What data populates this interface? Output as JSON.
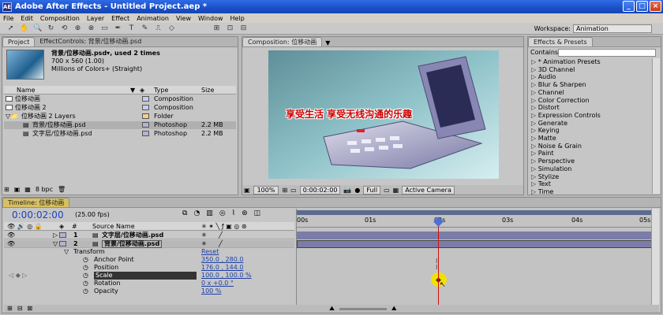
{
  "window": {
    "title": "Adobe After Effects - Untitled Project.aep *",
    "app_icon": "AE"
  },
  "menu": [
    "File",
    "Edit",
    "Composition",
    "Layer",
    "Effect",
    "Animation",
    "View",
    "Window",
    "Help"
  ],
  "workspace": {
    "label": "Workspace:",
    "value": "Animation"
  },
  "project": {
    "tabs": [
      "Project",
      "EffectControls: 背景/位移动画.psd"
    ],
    "info_name": "背景/位移动画.psd▾, used 2 times",
    "info_size": "700 x 560 (1.00)",
    "info_color": "Millions of Colors+ (Straight)",
    "columns": [
      "Name",
      "Type",
      "Size"
    ],
    "items": [
      {
        "name": "位移动画",
        "type": "Composition",
        "size": "",
        "label_color": "#c9c9f0",
        "icon": "composition-icon"
      },
      {
        "name": "位移动画 2",
        "type": "Composition",
        "size": "",
        "label_color": "#c9c9f0",
        "icon": "composition-icon"
      },
      {
        "name": "位移动画 2 Layers",
        "type": "Folder",
        "size": "",
        "label_color": "#f0d088",
        "icon": "folder-icon"
      },
      {
        "name": "背景/位移动画.psd",
        "type": "Photoshop",
        "size": "2.2 MB",
        "label_color": "#b3b3d4",
        "icon": "psd-file-icon"
      },
      {
        "name": "文字层/位移动画.psd",
        "type": "Photoshop",
        "size": "2.2 MB",
        "label_color": "#b3b3d4",
        "icon": "psd-file-icon"
      }
    ],
    "bpc": "8 bpc"
  },
  "composition": {
    "tab": "Composition: 位移动画",
    "banner_text": "享受生活 享受无线沟通的乐趣",
    "zoom": "100%",
    "time": "0:00:02:00",
    "resolution": "Full",
    "camera": "Active Camera"
  },
  "effects": {
    "tab": "Effects & Presets",
    "contains_label": "Contains:",
    "items": [
      "* Animation Presets",
      "3D Channel",
      "Audio",
      "Blur & Sharpen",
      "Channel",
      "Color Correction",
      "Distort",
      "Expression Controls",
      "Generate",
      "Keying",
      "Matte",
      "Noise & Grain",
      "Paint",
      "Perspective",
      "Simulation",
      "Stylize",
      "Text",
      "Time"
    ]
  },
  "timeline": {
    "tab": "Timeline: 位移动画",
    "current_time": "0:00:02:00",
    "fps": "(25.00 fps)",
    "source_name_header": "Source Name",
    "num_header": "#",
    "ruler": [
      "00s",
      "01s",
      "02s",
      "03s",
      "04s",
      "05s"
    ],
    "layers": [
      {
        "num": "1",
        "name": "文字层/位移动画.psd"
      },
      {
        "num": "2",
        "name": "背景/位移动画.psd"
      }
    ],
    "transform_label": "Transform",
    "reset_label": "Reset",
    "properties": [
      {
        "name": "Anchor Point",
        "value": "350.0 , 280.0"
      },
      {
        "name": "Position",
        "value": "176.0 , 144.0"
      },
      {
        "name": "Scale",
        "value": "100.0 , 100.0 %"
      },
      {
        "name": "Rotation",
        "value": "0 x +0.0 °"
      },
      {
        "name": "Opacity",
        "value": "100 %"
      }
    ]
  },
  "colors": {
    "accent_blue": "#2040c0",
    "title_blue": "#1a4fc8",
    "playhead": "#d01010",
    "keyframe_highlight": "#f4e000"
  }
}
